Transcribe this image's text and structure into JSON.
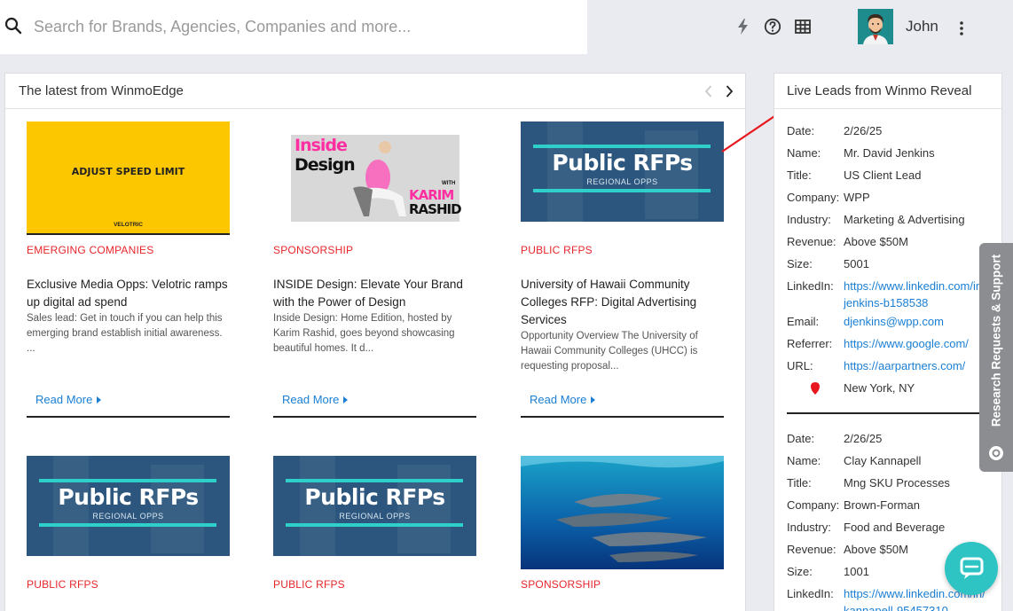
{
  "search": {
    "placeholder": "Search for Brands, Agencies, Companies and more..."
  },
  "user": {
    "name": "John"
  },
  "icons": {
    "search": "search-icon",
    "bolt": "bolt-icon",
    "help": "help-icon",
    "grid": "grid-icon",
    "more": "more-vertical-icon"
  },
  "main": {
    "title": "The latest from WinmoEdge",
    "cards": [
      {
        "thumb_text": "ADJUST SPEED LIMIT",
        "thumb_sub": "VELOTRIC",
        "category": "EMERGING COMPANIES",
        "title": "Exclusive Media Opps: Velotric ramps up digital ad spend",
        "desc": "Sales lead: Get in touch if you can help this emerging brand establish initial awareness. ...",
        "read_more": "Read More"
      },
      {
        "thumb_text_1": "Inside",
        "thumb_text_2": "Design",
        "thumb_with": "WITH",
        "thumb_name_1": "KARIM",
        "thumb_name_2": "RASHID",
        "category": "SPONSORSHIP",
        "title": "INSIDE Design: Elevate Your Brand with the Power of Design",
        "desc": "Inside Design: Home Edition, hosted by Karim Rashid, goes beyond showcasing beautiful homes. It d...",
        "read_more": "Read More"
      },
      {
        "thumb_big": "Public RFPs",
        "thumb_small": "REGIONAL OPPS",
        "category": "PUBLIC RFPS",
        "title": "University of Hawaii Community Colleges RFP: Digital Advertising Services",
        "desc": "Opportunity Overview The University of Hawaii Community Colleges (UHCC) is requesting proposal...",
        "read_more": "Read More"
      },
      {
        "thumb_big": "Public RFPs",
        "thumb_small": "REGIONAL OPPS",
        "category": "PUBLIC RFPS"
      },
      {
        "thumb_big": "Public RFPs",
        "thumb_small": "REGIONAL OPPS",
        "category": "PUBLIC RFPS"
      },
      {
        "category": "SPONSORSHIP"
      }
    ]
  },
  "leads": {
    "title": "Live Leads from Winmo Reveal",
    "labels": {
      "date": "Date:",
      "name": "Name:",
      "title": "Title:",
      "company": "Company:",
      "industry": "Industry:",
      "revenue": "Revenue:",
      "size": "Size:",
      "linkedin": "LinkedIn:",
      "email": "Email:",
      "referrer": "Referrer:",
      "url": "URL:"
    },
    "items": [
      {
        "date": "2/26/25",
        "name": "Mr. David Jenkins",
        "title": "US Client Lead",
        "company": "WPP",
        "industry": "Marketing & Advertising",
        "revenue": "Above $50M",
        "size": "5001",
        "linkedin_1": "https://www.linkedin.com/in/",
        "linkedin_2": "jenkins-b158538",
        "email": "djenkins@wpp.com",
        "referrer": "https://www.google.com/",
        "url": "https://aarpartners.com/",
        "location": "New York, NY"
      },
      {
        "date": "2/26/25",
        "name": "Clay Kannapell",
        "title": "Mng SKU Processes",
        "company": "Brown-Forman",
        "industry": "Food and Beverage",
        "revenue": "Above $50M",
        "size": "1001",
        "linkedin_1": "https://www.linkedin.com/in/",
        "linkedin_2": "kannapell-95457310"
      }
    ]
  },
  "side_tab": {
    "label": "Research Requests & Support"
  },
  "colors": {
    "accent": "#1a7fd4",
    "category": "#e8262a",
    "chat": "#2ec4c4",
    "rfp_bg": "#2c567d",
    "rfp_bar": "#2fd0c9"
  }
}
